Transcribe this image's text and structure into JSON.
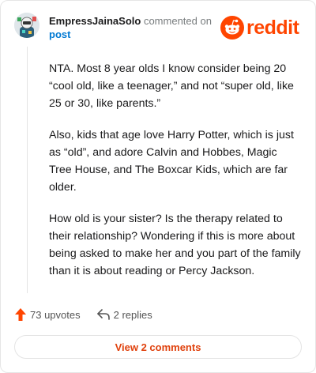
{
  "comment": {
    "username": "EmpressJainaSolo",
    "action": "commented on",
    "target": "post",
    "paragraphs": [
      "NTA. Most 8 year olds I know consider being 20 “cool old, like a teenager,” and not “super old, like 25 or 30, like parents.”",
      "Also, kids that age love Harry Potter, which is just as “old”, and adore Calvin and Hobbes, Magic Tree House, and The Boxcar Kids, which are far older.",
      "How old is your sister? Is the therapy related to their relationship? Wondering if this is more about being asked to make her and you part of the family than it is about reading or Percy Jackson."
    ]
  },
  "brand": {
    "wordmark": "reddit",
    "color": "#ff4500"
  },
  "actions": {
    "upvotes": "73 upvotes",
    "replies": "2 replies",
    "upvote_color": "#ff4500"
  },
  "view_comments": {
    "label": "View 2 comments",
    "color": "#e0420e"
  }
}
